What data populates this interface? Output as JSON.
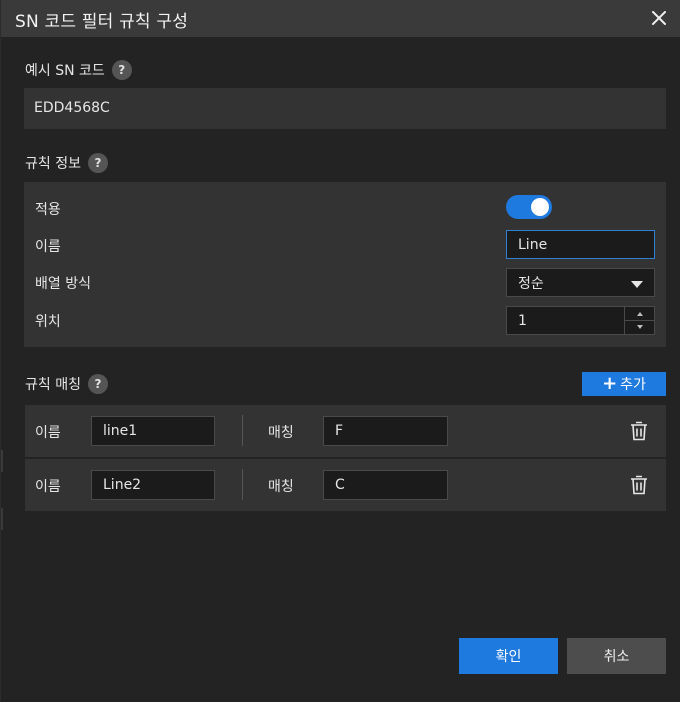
{
  "dialog": {
    "title": "SN 코드 필터 규칙 구성"
  },
  "sample": {
    "label": "예시 SN 코드",
    "value": "EDD4568C"
  },
  "rule_info": {
    "label": "규칙 정보",
    "apply_label": "적용",
    "apply_on": true,
    "name_label": "이름",
    "name_value": "Line",
    "order_label": "배열 방식",
    "order_value": "정순",
    "position_label": "위치",
    "position_value": "1"
  },
  "rule_match": {
    "label": "규칙 매칭",
    "add_label": "추가",
    "rows": [
      {
        "name_label": "이름",
        "name_value": "line1",
        "match_label": "매칭",
        "match_value": "F"
      },
      {
        "name_label": "이름",
        "name_value": "Line2",
        "match_label": "매칭",
        "match_value": "C"
      }
    ]
  },
  "footer": {
    "confirm_label": "확인",
    "cancel_label": "취소"
  },
  "colors": {
    "accent": "#1f7ae0",
    "title_bar": "#3a3a3a",
    "panel": "#333333",
    "background": "#232323"
  }
}
